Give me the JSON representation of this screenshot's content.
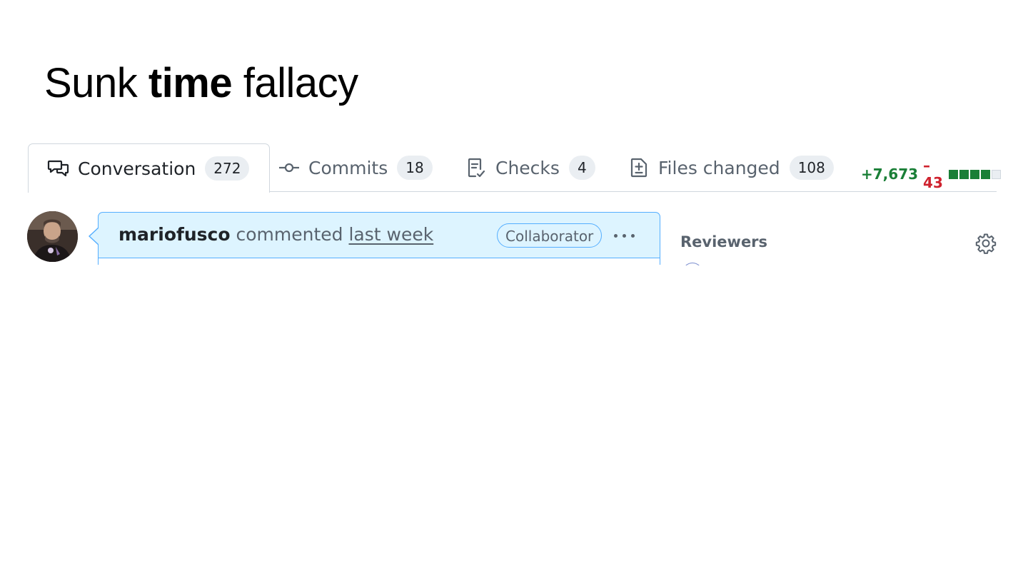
{
  "slide": {
    "title_pre": "Sunk ",
    "title_bold": "time",
    "title_post": " fallacy"
  },
  "tabs": [
    {
      "label": "Conversation",
      "count": "272",
      "icon": "comment-discussion-icon",
      "active": true
    },
    {
      "label": "Commits",
      "count": "18",
      "icon": "git-commit-icon",
      "active": false
    },
    {
      "label": "Checks",
      "count": "4",
      "icon": "checklist-icon",
      "active": false
    },
    {
      "label": "Files changed",
      "count": "108",
      "icon": "file-diff-icon",
      "active": false
    }
  ],
  "diffstat": {
    "additions": "+7,673",
    "deletions": "–43",
    "blocks": [
      "added",
      "added",
      "added",
      "added",
      "neutral"
    ],
    "colors": {
      "added": "#1a7f37",
      "deleted": "#cf222e",
      "neutral": "#eaeef2"
    }
  },
  "comment": {
    "author": "mariofusco",
    "action": "commented",
    "time": "last week",
    "role": "Collaborator",
    "menu_icon": "kebab-horizontal-icon",
    "colors": {
      "header_bg": "#ddf4ff",
      "border": "#54aeff"
    }
  },
  "sidebar": {
    "reviewers_heading": "Reviewers",
    "settings_icon": "gear-icon"
  }
}
